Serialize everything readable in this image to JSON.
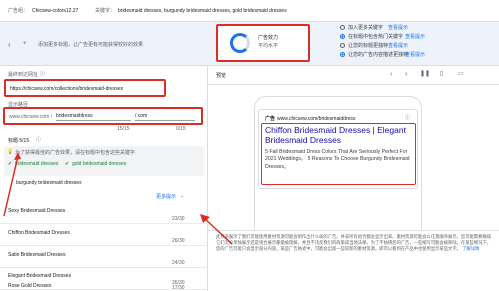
{
  "top": {
    "ad_group_label": "广告组：",
    "ad_group_value": "Chicsew-colors12.27",
    "keyword_label": "关键字：",
    "keyword_value": "bridesmaid dresses, burgundy bridesmaid dresses, gold bridesmaid dresses"
  },
  "band": {
    "message": "添加更多标题，让广告更有可能获得较好的效果",
    "strength_title": "广告效力",
    "strength_value": "平均水平",
    "suggestions": [
      "加入更多关键字",
      "在标题中包含热门关键字",
      "让您的标题更独特",
      "让您的广告内容描述更独特"
    ],
    "suggestion_link": "查看提示"
  },
  "form": {
    "final_url_label": "最终到达网址",
    "final_url_value": "https://chicsew.com/collections/bridesmaid-dresses",
    "display_path_label": "显示路径",
    "display_domain": "www.chicsew.com /",
    "path1": "bridesmaiddress",
    "path2": "/ com",
    "path1_count": "15/15",
    "path2_count": "0/15",
    "headlines_label": "标题 5/15",
    "tip": "为了获得最佳的广告效果，请在标题中包含这些关键字",
    "keyword_chips": [
      "bridesmaid dresses",
      "gold bridesmaid dresses"
    ],
    "keyword_extra": "burgundy bridesmaid dresses",
    "more_ideas": "更多提示",
    "headlines": [
      {
        "text": "Sexy Bridesmaid Dresses",
        "count": "23/30"
      },
      {
        "text": "Chiffon Bridesmaid Dresses",
        "count": "26/30"
      },
      {
        "text": "Satin Bridesmaid Dresses",
        "count": "24/30"
      },
      {
        "text": "Elegant Bridesmaid Dresses",
        "count": "26/30"
      },
      {
        "text": "Rose Gold Dresses",
        "count": "17/30"
      }
    ]
  },
  "preview": {
    "label": "预览",
    "ad_badge": "广告",
    "ad_url": "www.chicsew.com/bridesmaiddress",
    "headline": "Chiffon Bridesmaid Dresses | Elegant Bridesmaid Dresses",
    "description": "5 Fall Bridesmaid Dress Colors That Are Seriously Perfect For 2021 Weddings。 5 Reasons To Choose Burgundy Bridesmaid Dresses。",
    "disclaimer": "此预览展示了我们可能使用素材资源可能会制作出什么样的广告。并非所有组合都会显示出来。素材资源可能会以任意顺序展示，您可能需要确保它们无论单独展示还是组合展示都能被理解，并且不违反我们的政策或当地法律。为了不妨碍您的广告，一些缩写可能会被移除。在某些情况下，您的广告可能只会显示部分内容。某些广告格式中，可能会出现一些较新的素材资源。即可以看到在产品中也使用显示某些文字。",
    "learn_more": "了解详情"
  },
  "colors": {
    "accent": "#1a73e8",
    "red": "#d93025",
    "green": "#188038",
    "ad_title": "#1a0dab"
  }
}
